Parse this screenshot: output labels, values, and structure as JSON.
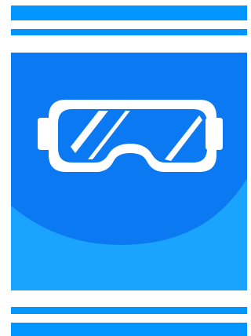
{
  "colors": {
    "stripe": "#0095ff",
    "panel_dark": "#0a79f2",
    "panel_light": "#1aa3ff",
    "goggles": "#ffffff"
  },
  "graphic": {
    "icon": "vr-goggles-icon"
  }
}
